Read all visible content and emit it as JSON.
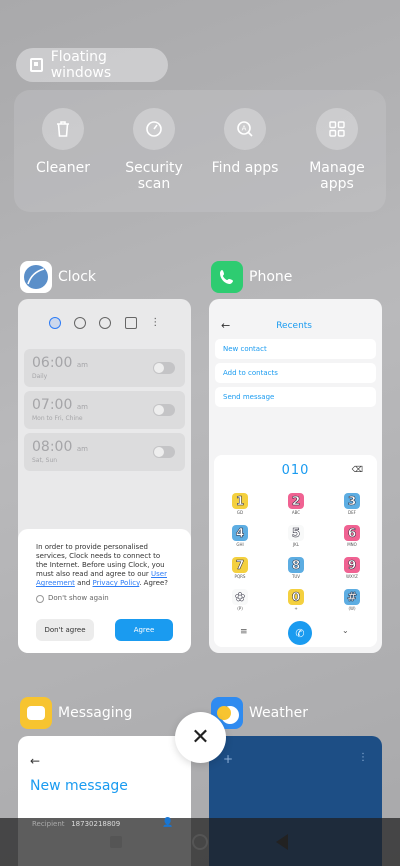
{
  "floating": {
    "label": "Floating windows"
  },
  "tools": [
    {
      "label": "Cleaner",
      "icon": "trash-icon"
    },
    {
      "label": "Security\nscan",
      "icon": "speedometer-icon"
    },
    {
      "label": "Find apps",
      "icon": "search-app-icon"
    },
    {
      "label": "Manage\napps",
      "icon": "grid-icon"
    }
  ],
  "clock": {
    "app_name": "Clock",
    "alarms": [
      {
        "time": "06:00",
        "ampm": "am",
        "sub": "Daily"
      },
      {
        "time": "07:00",
        "ampm": "am",
        "sub": "Mon to Fri, Chine"
      },
      {
        "time": "08:00",
        "ampm": "am",
        "sub": "Sat, Sun"
      }
    ],
    "consent": {
      "text_1": "In order to provide personalised services, Clock needs to connect to the Internet. Before using Clock, you must also read and agree to our ",
      "link_1": "User Agreement",
      "text_2": " and ",
      "link_2": "Privacy Policy",
      "text_3": ". Agree?",
      "dont_show": "Don't show again",
      "disagree": "Don't agree",
      "agree": "Agree"
    }
  },
  "phone": {
    "app_name": "Phone",
    "title": "Recents",
    "rows": [
      "New contact",
      "Add to contacts",
      "Send message"
    ],
    "number": "010",
    "keys": [
      {
        "d": "1",
        "l": "GD",
        "c": "#f4d03f"
      },
      {
        "d": "2",
        "l": "ABC",
        "c": "#f06292"
      },
      {
        "d": "3",
        "l": "DEF",
        "c": "#5dade2"
      },
      {
        "d": "4",
        "l": "GHI",
        "c": "#5dade2"
      },
      {
        "d": "5",
        "l": "JKL",
        "c": "#f8f9f9"
      },
      {
        "d": "6",
        "l": "MNO",
        "c": "#f06292"
      },
      {
        "d": "7",
        "l": "PQRS",
        "c": "#f4d03f"
      },
      {
        "d": "8",
        "l": "TUV",
        "c": "#5dade2"
      },
      {
        "d": "9",
        "l": "WXYZ",
        "c": "#f06292"
      },
      {
        "d": "✿",
        "l": "(P)",
        "c": "#f8f9f9"
      },
      {
        "d": "0",
        "l": "+",
        "c": "#f4d03f"
      },
      {
        "d": "#",
        "l": "(W)",
        "c": "#5dade2"
      }
    ]
  },
  "messaging": {
    "app_name": "Messaging",
    "title": "New message",
    "recipient_label": "Recipient",
    "recipient": "18730218809"
  },
  "weather": {
    "app_name": "Weather"
  }
}
